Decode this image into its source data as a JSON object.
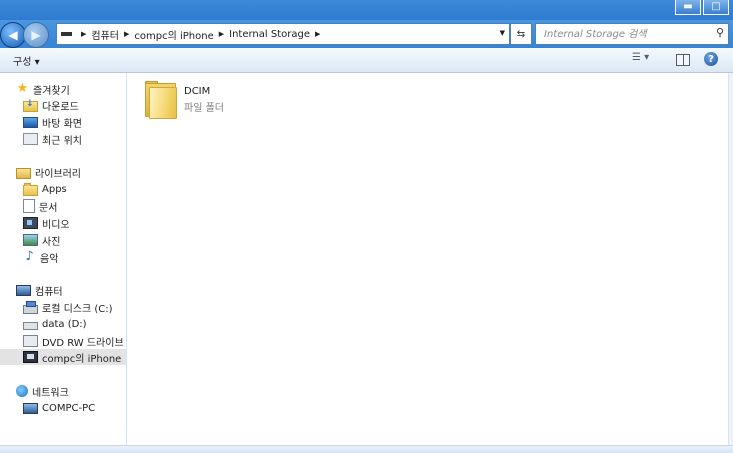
{
  "window": {
    "buttons": {
      "minimize": "▬",
      "maximize": "□"
    }
  },
  "address": {
    "crumbs": [
      "컴퓨터",
      "compc의 iPhone",
      "Internal Storage"
    ],
    "search_placeholder": "Internal Storage 검색"
  },
  "toolbar": {
    "organize": "구성 ▾",
    "help": "?"
  },
  "sidebar": {
    "favorites": {
      "label": "즐겨찾기",
      "items": [
        "다운로드",
        "바탕 화면",
        "최근 위치"
      ]
    },
    "libraries": {
      "label": "라이브러리",
      "items": [
        "Apps",
        "문서",
        "비디오",
        "사진",
        "음악"
      ]
    },
    "computer": {
      "label": "컴퓨터",
      "items": [
        "로컬 디스크 (C:)",
        "data (D:)",
        "DVD RW 드라이브 (",
        "compc의 iPhone"
      ]
    },
    "network": {
      "label": "네트워크",
      "items": [
        "COMPC-PC"
      ]
    }
  },
  "content": {
    "items": [
      {
        "name": "DCIM",
        "type": "파일 폴더"
      }
    ]
  }
}
